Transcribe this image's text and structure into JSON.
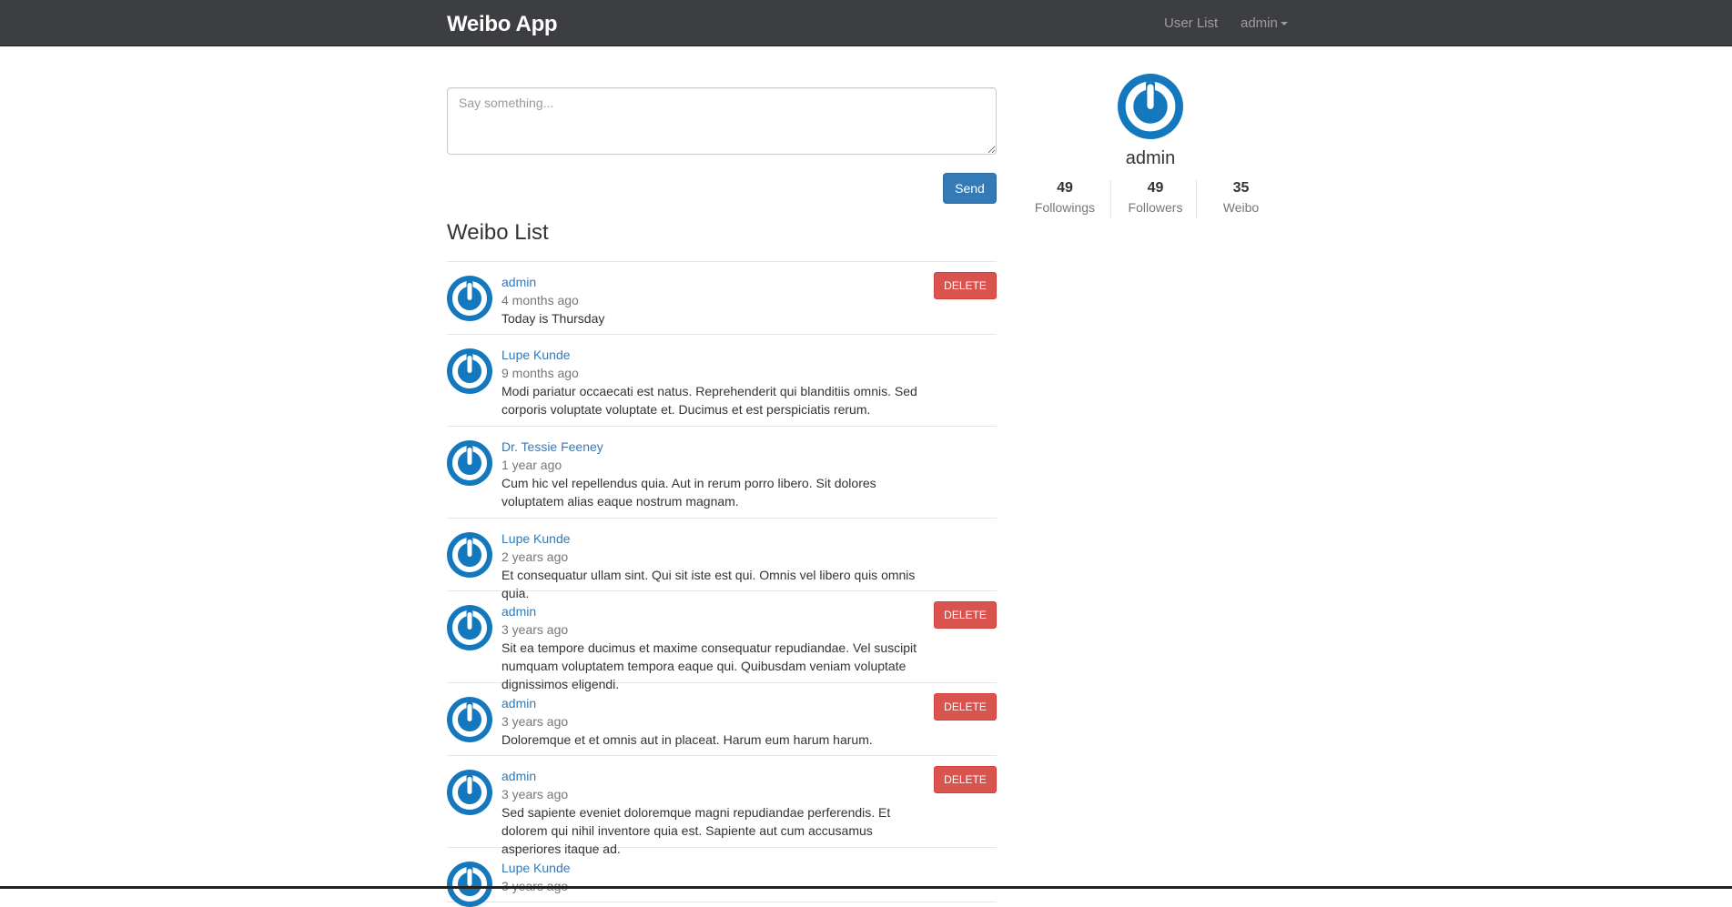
{
  "navbar": {
    "brand": "Weibo App",
    "links": {
      "user_list": "User List",
      "user_menu": "admin"
    }
  },
  "compose": {
    "placeholder": "Say something...",
    "send_label": "Send"
  },
  "weibo_list": {
    "title": "Weibo List",
    "delete_label": "DELETE",
    "items": [
      {
        "user": "admin",
        "time": "4 months ago",
        "text": "Today is Thursday",
        "deletable": true
      },
      {
        "user": "Lupe Kunde",
        "time": "9 months ago",
        "text": "Modi pariatur occaecati est natus. Reprehenderit qui blanditiis omnis. Sed corporis voluptate voluptate et. Ducimus et est perspiciatis rerum.",
        "deletable": false
      },
      {
        "user": "Dr. Tessie Feeney",
        "time": "1 year ago",
        "text": "Cum hic vel repellendus quia. Aut in rerum porro libero. Sit dolores voluptatem alias eaque nostrum magnam.",
        "deletable": false
      },
      {
        "user": "Lupe Kunde",
        "time": "2 years ago",
        "text": "Et consequatur ullam sint. Qui sit iste est qui. Omnis vel libero quis omnis quia.",
        "deletable": false
      },
      {
        "user": "admin",
        "time": "3 years ago",
        "text": "Sit ea tempore ducimus et maxime consequatur repudiandae. Vel suscipit numquam voluptatem tempora eaque qui. Quibusdam veniam voluptate dignissimos eligendi.",
        "deletable": true
      },
      {
        "user": "admin",
        "time": "3 years ago",
        "text": "Doloremque et et omnis aut in placeat. Harum eum harum harum.",
        "deletable": true
      },
      {
        "user": "admin",
        "time": "3 years ago",
        "text": "Sed sapiente eveniet doloremque magni repudiandae perferendis. Et dolorem qui nihil inventore quia est. Sapiente aut cum accusamus asperiores itaque ad.",
        "deletable": true
      },
      {
        "user": "Lupe Kunde",
        "time": "3 years ago",
        "text": "",
        "deletable": false
      }
    ]
  },
  "profile": {
    "name": "admin",
    "stats": [
      {
        "value": "49",
        "label": "Followings"
      },
      {
        "value": "49",
        "label": "Followers"
      },
      {
        "value": "35",
        "label": "Weibo"
      }
    ]
  },
  "colors": {
    "navbar_bg": "#3d3e41",
    "link": "#337ab7",
    "primary": "#337ab7",
    "danger": "#d9534f",
    "avatar_blue": "#1378bd"
  },
  "icons": {
    "avatar": "power-avatar-icon",
    "dropdown": "caret-down-icon"
  }
}
